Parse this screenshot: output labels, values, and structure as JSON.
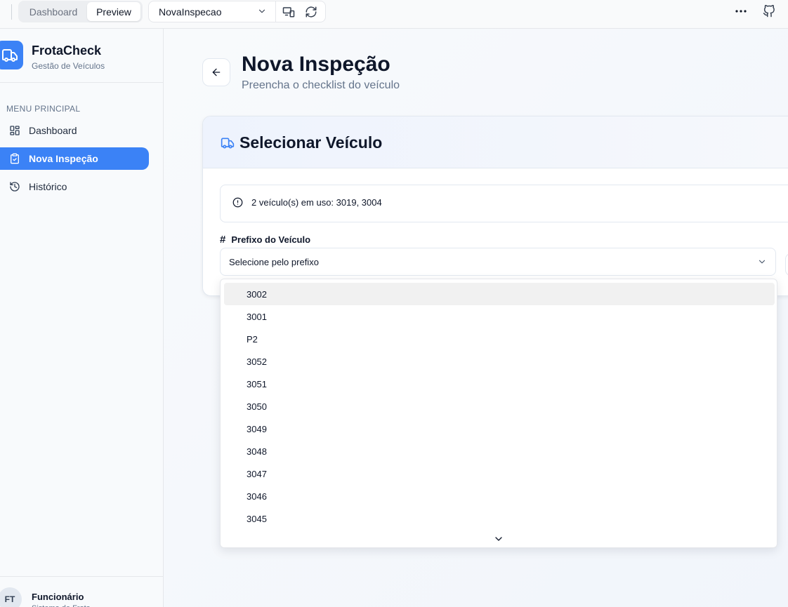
{
  "topbar": {
    "tabs": [
      "Dashboard",
      "Preview"
    ],
    "active_tab": "Preview",
    "page_select": "NovaInspecao"
  },
  "sidebar": {
    "brand": "FrotaCheck",
    "brand_sub": "Gestão de Veículos",
    "menu_label": "MENU PRINCIPAL",
    "items": [
      {
        "label": "Dashboard",
        "icon": "dashboard-icon"
      },
      {
        "label": "Nova Inspeção",
        "icon": "clipboard-check-icon",
        "active": true
      },
      {
        "label": "Histórico",
        "icon": "history-icon"
      }
    ],
    "user": {
      "initials": "FT",
      "name": "Funcionário",
      "role": "Sistema de Frota"
    }
  },
  "main": {
    "title": "Nova Inspeção",
    "subtitle": "Preencha o checklist do veículo",
    "card": {
      "title": "Selecionar Veículo",
      "alert": "2 veículo(s) em uso: 3019, 3004",
      "field_label": "Prefixo do Veículo",
      "select_placeholder": "Selecione pelo prefixo"
    }
  },
  "dropdown": {
    "options": [
      "3002",
      "3001",
      "P2",
      "3052",
      "3051",
      "3050",
      "3049",
      "3048",
      "3047",
      "3046",
      "3045"
    ],
    "highlighted": "3002"
  },
  "colors": {
    "accent": "#3b82f6",
    "text": "#0f172a",
    "muted": "#64748b",
    "border": "#e2e8f0"
  }
}
